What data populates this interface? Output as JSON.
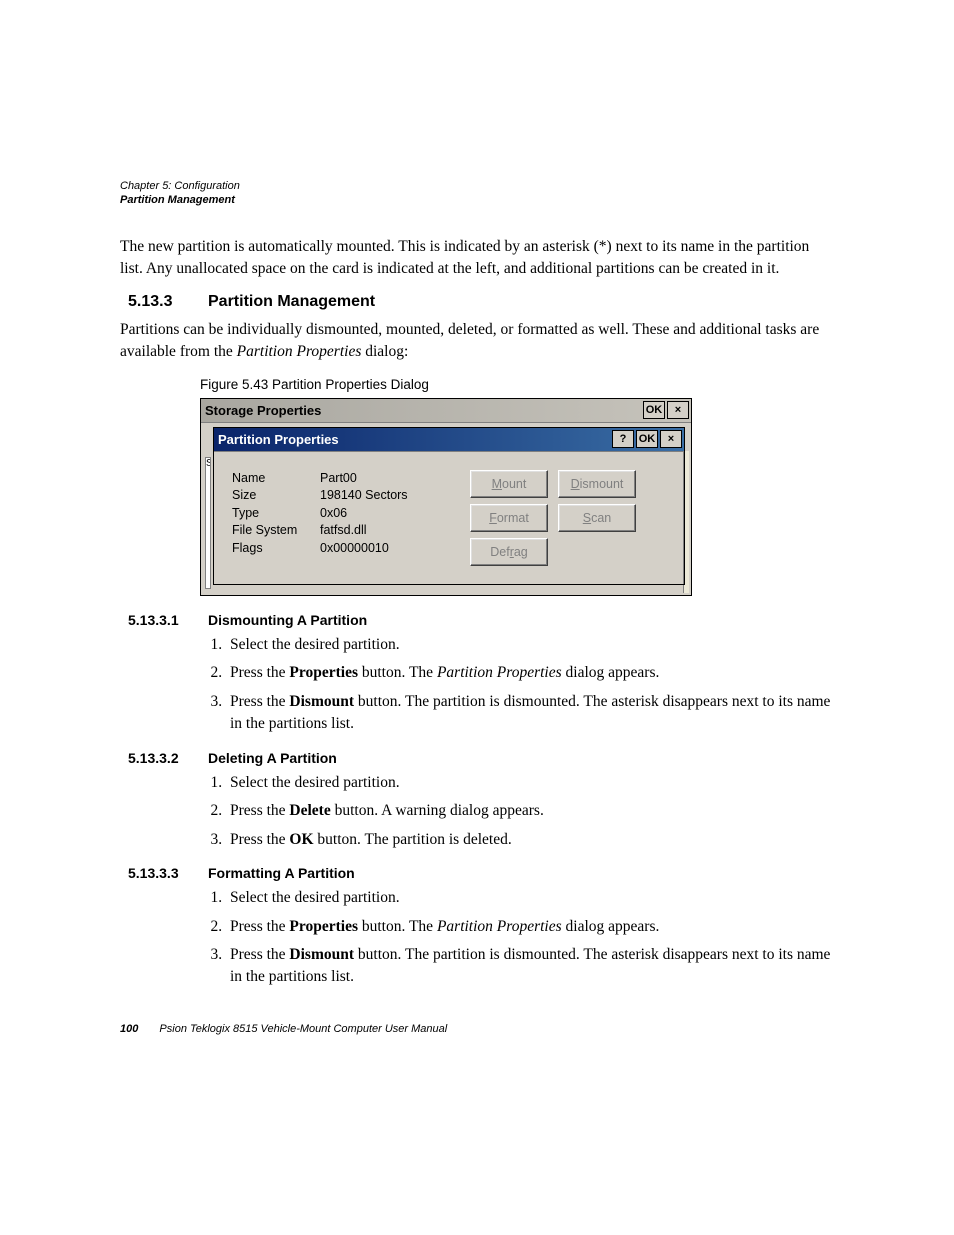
{
  "header": {
    "chapter": "Chapter 5: Configuration",
    "section": "Partition Management"
  },
  "intro_para": "The new partition is automatically mounted. This is indicated by an asterisk (*) next to its name in the partition list. Any unallocated space on the card is indicated at the left, and additional partitions can be created in it.",
  "h3": {
    "num": "5.13.3",
    "title": "Partition Management"
  },
  "h3_para_before": "Partitions can be individually dismounted, mounted, deleted, or formatted as well. These and additional tasks are available from the ",
  "h3_para_em": "Partition Properties",
  "h3_para_after": " dialog:",
  "figure_caption": "Figure 5.43 Partition Properties Dialog",
  "dialog": {
    "outer_title": "Storage Properties",
    "outer_ok": "OK",
    "outer_close": "×",
    "inner_title": "Partition Properties",
    "inner_help": "?",
    "inner_ok": "OK",
    "inner_close": "×",
    "kv": {
      "name_l": "Name",
      "name_v": "Part00",
      "size_l": "Size",
      "size_v": "198140 Sectors",
      "type_l": "Type",
      "type_v": "0x06",
      "fs_l": "File System",
      "fs_v": "fatfsd.dll",
      "flags_l": "Flags",
      "flags_v": "0x00000010"
    },
    "buttons": {
      "mount_pre": "",
      "mount_u": "M",
      "mount_post": "ount",
      "dismount_pre": "",
      "dismount_u": "D",
      "dismount_post": "ismount",
      "format_pre": "",
      "format_u": "F",
      "format_post": "ormat",
      "scan_pre": "",
      "scan_u": "S",
      "scan_post": "can",
      "defrag_pre": "Def",
      "defrag_u": "r",
      "defrag_post": "ag"
    }
  },
  "s1": {
    "num": "5.13.3.1",
    "title": "Dismounting A Partition",
    "step1": "Select the desired partition.",
    "step2a": "Press the ",
    "step2b": "Properties",
    "step2c": " button. The ",
    "step2d": "Partition Properties",
    "step2e": " dialog appears.",
    "step3a": "Press the ",
    "step3b": "Dismount",
    "step3c": " button. The partition is dismounted. The asterisk disappears next to its name in the partitions list."
  },
  "s2": {
    "num": "5.13.3.2",
    "title": "Deleting A Partition",
    "step1": "Select the desired partition.",
    "step2a": "Press the ",
    "step2b": "Delete",
    "step2c": " button. A warning dialog appears.",
    "step3a": "Press the ",
    "step3b": "OK",
    "step3c": " button. The partition is deleted."
  },
  "s3": {
    "num": "5.13.3.3",
    "title": "Formatting A Partition",
    "step1": "Select the desired partition.",
    "step2a": "Press the ",
    "step2b": "Properties",
    "step2c": " button. The ",
    "step2d": "Partition Properties",
    "step2e": " dialog appears.",
    "step3a": "Press the ",
    "step3b": "Dismount",
    "step3c": " button. The partition is dismounted. The asterisk disappears next to its name in the partitions list."
  },
  "footer": {
    "page": "100",
    "text": "Psion Teklogix 8515 Vehicle-Mount Computer User Manual"
  }
}
